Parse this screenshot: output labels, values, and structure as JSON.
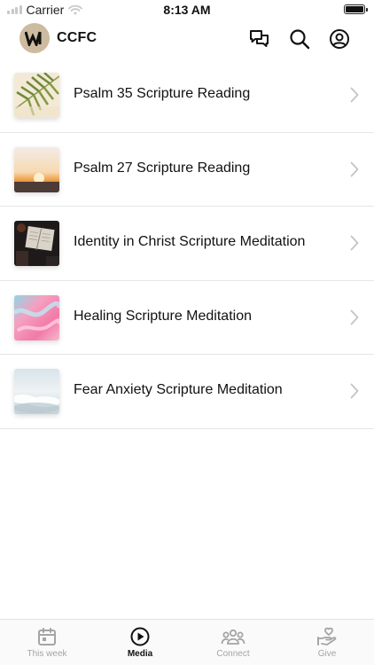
{
  "status_bar": {
    "carrier": "Carrier",
    "time": "8:13 AM"
  },
  "header": {
    "app_name": "CCFC",
    "logo_glyph": "W",
    "icons": [
      "chat-icon",
      "search-icon",
      "profile-icon"
    ]
  },
  "media_items": [
    {
      "title": "Psalm 35 Scripture Reading",
      "thumbnail": "palm leaves"
    },
    {
      "title": "Psalm 27 Scripture Reading",
      "thumbnail": "sunset horizon"
    },
    {
      "title": "Identity in Christ Scripture Meditation",
      "thumbnail": "open bible"
    },
    {
      "title": "Healing Scripture Meditation",
      "thumbnail": "pastel paint"
    },
    {
      "title": "Fear Anxiety Scripture Meditation",
      "thumbnail": "clouds"
    }
  ],
  "tab_bar": {
    "active": "Media",
    "tabs": [
      {
        "label": "This week",
        "icon": "calendar-icon"
      },
      {
        "label": "Media",
        "icon": "play-circle-icon"
      },
      {
        "label": "Connect",
        "icon": "people-icon"
      },
      {
        "label": "Give",
        "icon": "heart-hand-icon"
      }
    ]
  },
  "colors": {
    "logo_background": "#cdbba0",
    "divider": "#e6e6e6",
    "tab_inactive": "#a4a4a4",
    "tab_active": "#111111"
  }
}
